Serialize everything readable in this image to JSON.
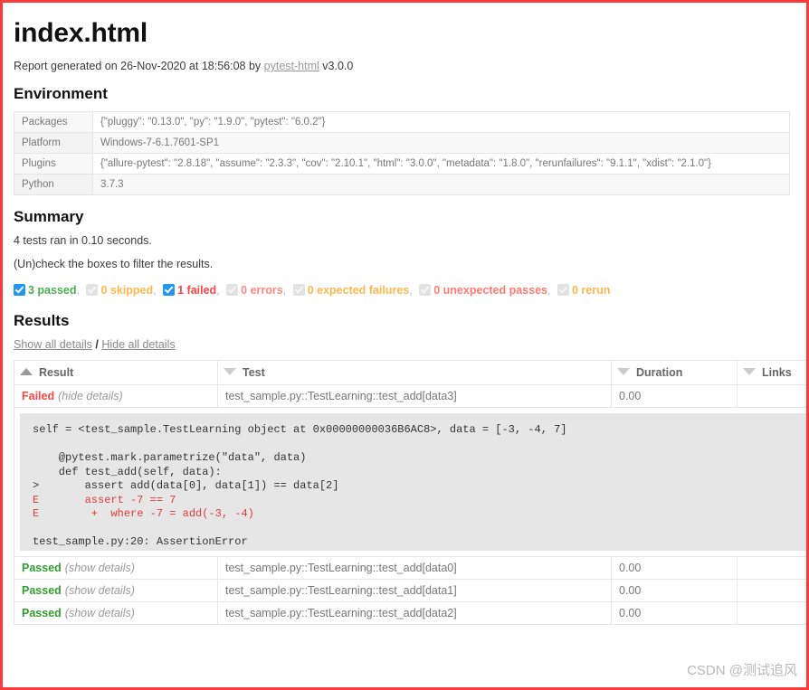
{
  "report": {
    "title": "index.html",
    "generated_prefix": "Report generated on",
    "date": "26-Nov-2020",
    "at_word": "at",
    "time": "18:56:08",
    "by_word": "by",
    "tool_link": "pytest-html",
    "tool_version": "v3.0.0"
  },
  "environment": {
    "heading": "Environment",
    "rows": [
      {
        "key": "Packages",
        "value": "{\"pluggy\": \"0.13.0\", \"py\": \"1.9.0\", \"pytest\": \"6.0.2\"}"
      },
      {
        "key": "Platform",
        "value": "Windows-7-6.1.7601-SP1"
      },
      {
        "key": "Plugins",
        "value": "{\"allure-pytest\": \"2.8.18\", \"assume\": \"2.3.3\", \"cov\": \"2.10.1\", \"html\": \"3.0.0\", \"metadata\": \"1.8.0\", \"rerunfailures\": \"9.1.1\", \"xdist\": \"2.1.0\"}"
      },
      {
        "key": "Python",
        "value": "3.7.3"
      }
    ]
  },
  "summary": {
    "heading": "Summary",
    "run_line": "4 tests ran in 0.10 seconds.",
    "filter_hint": "(Un)check the boxes to filter the results.",
    "filters": [
      {
        "label": "3 passed",
        "checked": true,
        "color": "#4caf50",
        "trailing": ","
      },
      {
        "label": "0 skipped",
        "checked": false,
        "color": "#ffb74d",
        "trailing": ","
      },
      {
        "label": "1 failed",
        "checked": true,
        "color": "#ff4444",
        "trailing": ","
      },
      {
        "label": "0 errors",
        "checked": false,
        "color": "#ff8a80",
        "trailing": ","
      },
      {
        "label": "0 expected failures",
        "checked": false,
        "color": "#ffb74d",
        "trailing": ","
      },
      {
        "label": "0 unexpected passes",
        "checked": false,
        "color": "#ff7b72",
        "trailing": ","
      },
      {
        "label": "0 rerun",
        "checked": false,
        "color": "#ffb74d",
        "trailing": ""
      }
    ]
  },
  "results": {
    "heading": "Results",
    "show_all": "Show all details",
    "slash": "/",
    "hide_all": "Hide all details",
    "columns": [
      {
        "label": "Result",
        "sort": "up"
      },
      {
        "label": "Test",
        "sort": "down"
      },
      {
        "label": "Duration",
        "sort": "down"
      },
      {
        "label": "Links",
        "sort": "down"
      }
    ],
    "rows": [
      {
        "result": "Failed",
        "toggle": "(hide details)",
        "test": "test_sample.py::TestLearning::test_add[data3]",
        "duration": "0.00",
        "links": ""
      },
      {
        "result": "Passed",
        "toggle": "(show details)",
        "test": "test_sample.py::TestLearning::test_add[data0]",
        "duration": "0.00",
        "links": ""
      },
      {
        "result": "Passed",
        "toggle": "(show details)",
        "test": "test_sample.py::TestLearning::test_add[data1]",
        "duration": "0.00",
        "links": ""
      },
      {
        "result": "Passed",
        "toggle": "(show details)",
        "test": "test_sample.py::TestLearning::test_add[data2]",
        "duration": "0.00",
        "links": ""
      }
    ],
    "log": {
      "line1": "self = <test_sample.TestLearning object at 0x00000000036B6AC8>, data = [-3, -4, 7]",
      "line2": "",
      "line3": "    @pytest.mark.parametrize(\"data\", data)",
      "line4": "    def test_add(self, data):",
      "line5": ">       assert add(data[0], data[1]) == data[2]",
      "line6_err": "E       assert -7 == 7",
      "line7_err": "E        +  where -7 = add(-3, -4)",
      "line8": "",
      "line9": "test_sample.py:20: AssertionError"
    }
  },
  "watermark": "CSDN @测试追风"
}
